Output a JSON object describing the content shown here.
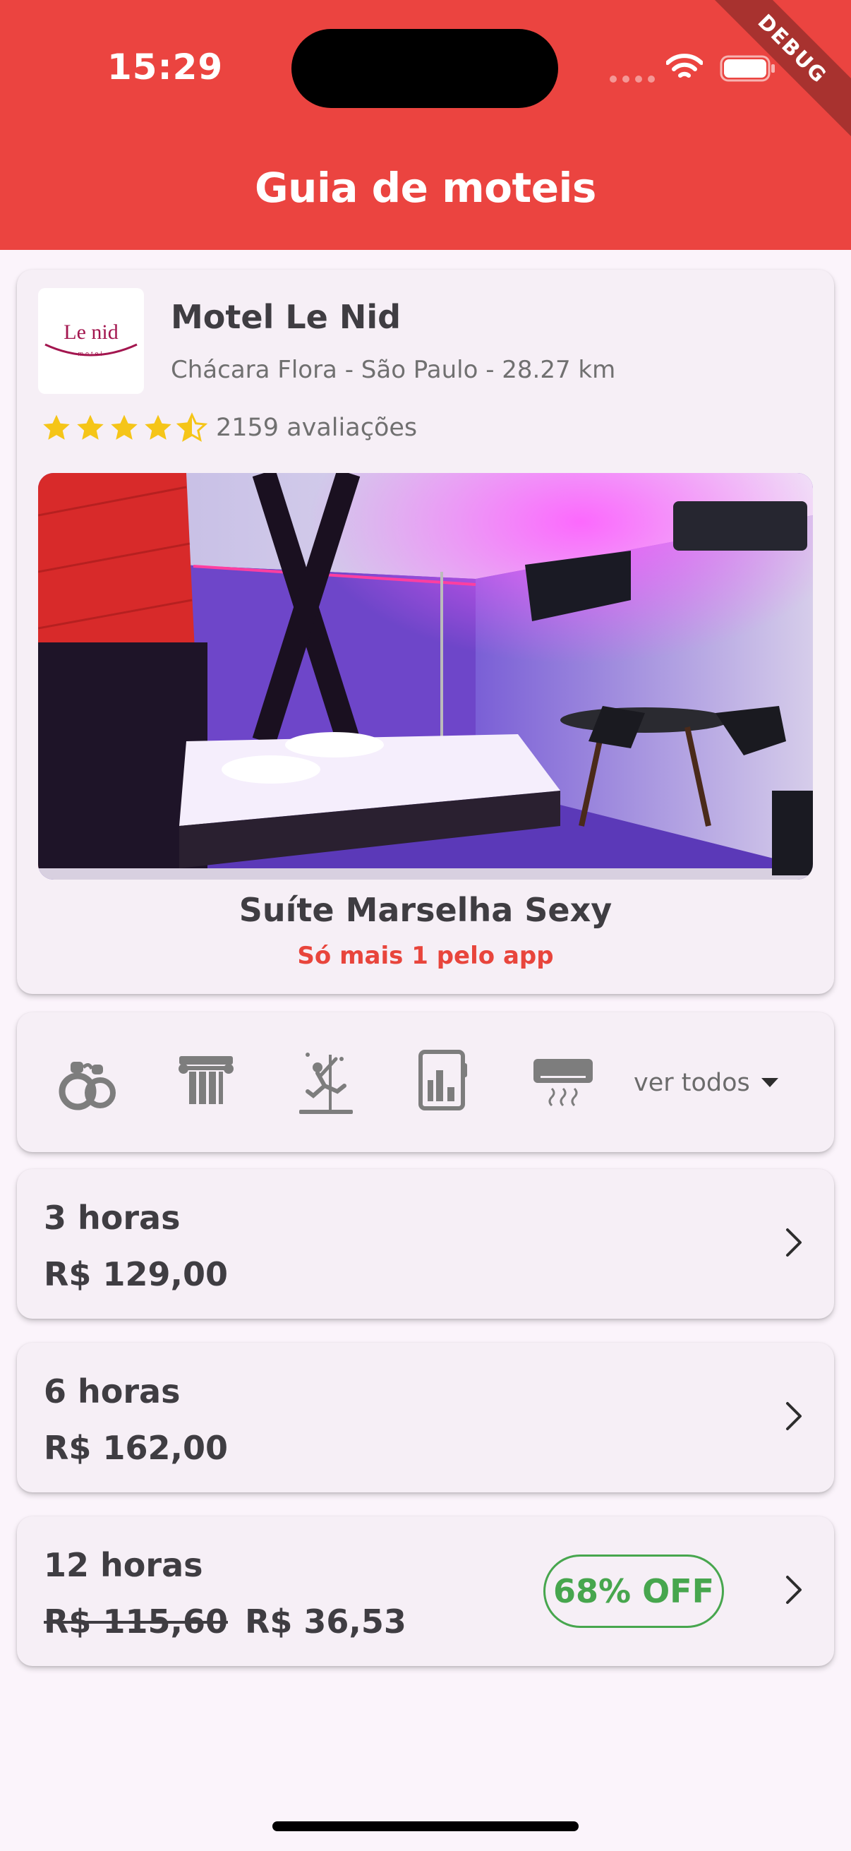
{
  "status_bar": {
    "time": "15:29"
  },
  "debug_banner": "DEBUG",
  "app_bar": {
    "title": "Guia de moteis"
  },
  "motel": {
    "logo_text": "Le nid",
    "logo_subtext": "motel",
    "name": "Motel Le Nid",
    "location": "Chácara Flora - São Paulo - 28.27 km",
    "rating": 4.5,
    "reviews": "2159 avaliações",
    "suite_name": "Suíte Marselha Sexy",
    "suite_promo": "Só mais 1 pelo app"
  },
  "amenities": {
    "icons": [
      "handcuffs-icon",
      "column-icon",
      "pole-dance-icon",
      "minibar-icon",
      "air-conditioner-icon"
    ],
    "see_all_label": "ver todos"
  },
  "prices": [
    {
      "duration": "3 horas",
      "price": "R$ 129,00"
    },
    {
      "duration": "6 horas",
      "price": "R$ 162,00"
    },
    {
      "duration": "12 horas",
      "old_price": "R$ 115,60",
      "price": "R$ 36,53",
      "discount": "68% OFF"
    }
  ],
  "colors": {
    "primary": "#eb4440",
    "discount": "#47a64e",
    "star": "#f5c518",
    "background": "#fbf4fb"
  }
}
